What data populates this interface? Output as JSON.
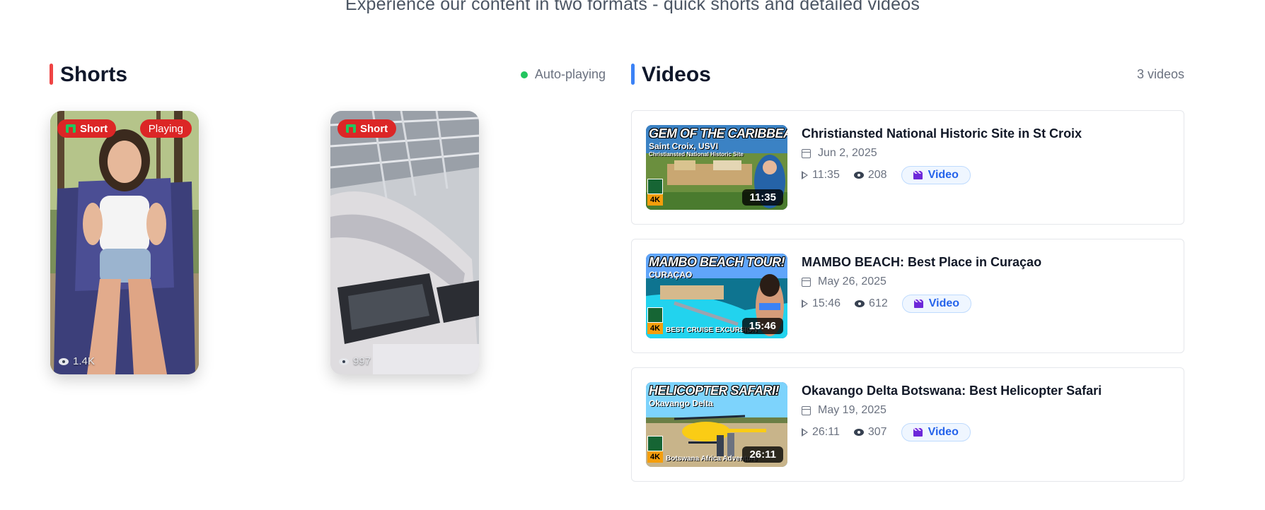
{
  "subtitle": "Experience our content in two formats - quick shorts and detailed videos",
  "shorts": {
    "title": "Shorts",
    "status": "Auto-playing",
    "items": [
      {
        "badge": "Short",
        "status_badge": "Playing",
        "views": "1.4K"
      },
      {
        "badge": "Short",
        "views": "997"
      }
    ]
  },
  "videos": {
    "title": "Videos",
    "count": "3 videos",
    "items": [
      {
        "title": "Christiansted National Historic Site in St Croix",
        "date": "Jun 2, 2025",
        "duration": "11:35",
        "views": "208",
        "tag": "Video",
        "thumb": {
          "title": "GEM OF THE CARIBBEAN!",
          "subtitle": "Saint Croix, USVI",
          "caption": "Christiansted National Historic Site",
          "duration": "11:35",
          "logo": "4K"
        }
      },
      {
        "title": "MAMBO BEACH: Best Place in Curaçao",
        "date": "May 26, 2025",
        "duration": "15:46",
        "views": "612",
        "tag": "Video",
        "thumb": {
          "title": "MAMBO BEACH TOUR!",
          "subtitle": "CURAÇAO",
          "caption": "BEST CRUISE EXCURSION",
          "duration": "15:46",
          "logo": "4K"
        }
      },
      {
        "title": "Okavango Delta Botswana: Best Helicopter Safari",
        "date": "May 19, 2025",
        "duration": "26:11",
        "views": "307",
        "tag": "Video",
        "thumb": {
          "title": "HELICOPTER SAFARI!",
          "subtitle": "Okavango Delta",
          "caption": "Botswana Africa Adventure",
          "duration": "26:11",
          "logo": "4K"
        }
      }
    ]
  },
  "colors": {
    "shorts_accent": "#ef4444",
    "videos_accent": "#3b82f6",
    "badge_red": "#dc2626",
    "autoplay_dot": "#22c55e",
    "video_tag_text": "#2563eb"
  }
}
